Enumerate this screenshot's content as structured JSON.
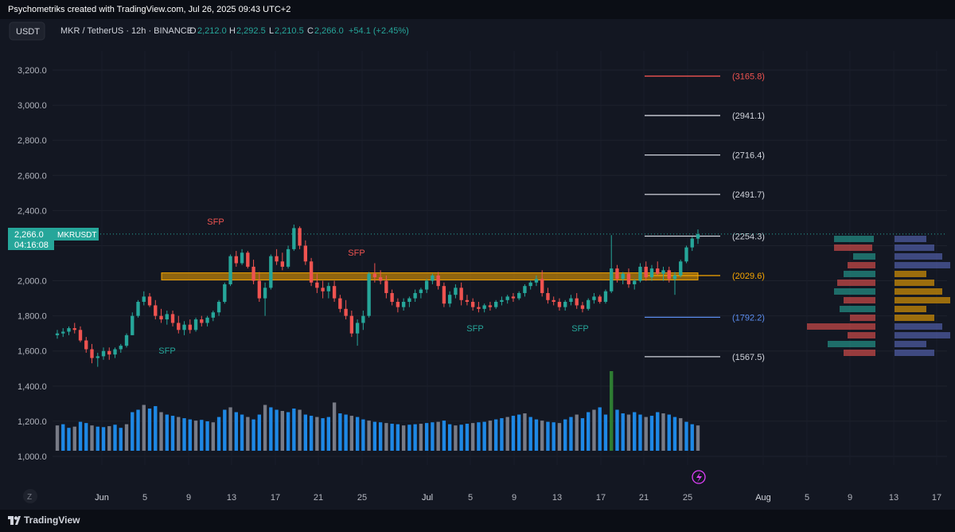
{
  "header": {
    "credit": "Psychometriks created with TradingView.com, Jul 26, 2025 09:43 UTC+2",
    "currency_button": "USDT",
    "symbol": "MKR / TetherUS · 12h · BINANCE",
    "o_label": "O",
    "o": "2,212.0",
    "h_label": "H",
    "h": "2,292.5",
    "l_label": "L",
    "l": "2,210.5",
    "c_label": "C",
    "c": "2,266.0",
    "change": "+54.1 (+2.45%)"
  },
  "price_tag": {
    "price": "2,266.0",
    "countdown": "04:16:08",
    "symbol": "MKRUSDT"
  },
  "footer": {
    "brand": "TradingView",
    "z_button": "Z"
  },
  "colors": {
    "up": "#26a69a",
    "down": "#ef5350",
    "bg": "#131722",
    "grid": "#1e222d",
    "zone": "#f7a600"
  },
  "chart_data": {
    "type": "candlestick",
    "symbol": "MKRUSDT",
    "interval": "12h",
    "ylim": [
      950,
      3350
    ],
    "y_ticks": [
      "3,200.0",
      "3,000.0",
      "2,800.0",
      "2,600.0",
      "2,400.0",
      "2,200.0",
      "2,000.0",
      "1,800.0",
      "1,600.0",
      "1,400.0",
      "1,200.0",
      "1,000.0"
    ],
    "y_tick_values": [
      3200,
      3000,
      2800,
      2600,
      2400,
      2200,
      2000,
      1800,
      1600,
      1400,
      1200,
      1000
    ],
    "x_ticks": [
      "Jun",
      "5",
      "9",
      "13",
      "17",
      "21",
      "25",
      "Jul",
      "5",
      "9",
      "13",
      "17",
      "21",
      "25",
      "Aug",
      "5",
      "9",
      "13",
      "17"
    ],
    "candles": [
      [
        1690,
        1720,
        1670,
        1700
      ],
      [
        1700,
        1730,
        1680,
        1710
      ],
      [
        1710,
        1740,
        1690,
        1730
      ],
      [
        1730,
        1760,
        1700,
        1720
      ],
      [
        1720,
        1740,
        1650,
        1660
      ],
      [
        1660,
        1680,
        1590,
        1610
      ],
      [
        1610,
        1640,
        1530,
        1560
      ],
      [
        1560,
        1590,
        1510,
        1570
      ],
      [
        1570,
        1620,
        1550,
        1600
      ],
      [
        1600,
        1620,
        1550,
        1580
      ],
      [
        1580,
        1620,
        1560,
        1610
      ],
      [
        1610,
        1640,
        1590,
        1630
      ],
      [
        1630,
        1700,
        1620,
        1690
      ],
      [
        1690,
        1820,
        1690,
        1800
      ],
      [
        1800,
        1890,
        1790,
        1880
      ],
      [
        1880,
        1940,
        1860,
        1910
      ],
      [
        1910,
        1930,
        1850,
        1860
      ],
      [
        1860,
        1890,
        1780,
        1800
      ],
      [
        1800,
        1840,
        1760,
        1780
      ],
      [
        1780,
        1830,
        1750,
        1810
      ],
      [
        1810,
        1830,
        1740,
        1760
      ],
      [
        1760,
        1800,
        1700,
        1720
      ],
      [
        1720,
        1770,
        1690,
        1750
      ],
      [
        1750,
        1780,
        1700,
        1720
      ],
      [
        1720,
        1790,
        1710,
        1780
      ],
      [
        1780,
        1800,
        1740,
        1760
      ],
      [
        1760,
        1800,
        1740,
        1790
      ],
      [
        1790,
        1830,
        1770,
        1820
      ],
      [
        1820,
        1890,
        1800,
        1880
      ],
      [
        1880,
        1990,
        1870,
        1980
      ],
      [
        1980,
        2150,
        1970,
        2140
      ],
      [
        2140,
        2170,
        2080,
        2100
      ],
      [
        2100,
        2180,
        2090,
        2160
      ],
      [
        2160,
        2170,
        2070,
        2080
      ],
      [
        2080,
        2120,
        1980,
        2000
      ],
      [
        2000,
        2050,
        1880,
        1900
      ],
      [
        1900,
        1990,
        1800,
        1960
      ],
      [
        1960,
        2150,
        1950,
        2140
      ],
      [
        2140,
        2180,
        2090,
        2110
      ],
      [
        2110,
        2160,
        2060,
        2080
      ],
      [
        2080,
        2200,
        2070,
        2180
      ],
      [
        2180,
        2320,
        2170,
        2300
      ],
      [
        2300,
        2310,
        2180,
        2200
      ],
      [
        2200,
        2230,
        2090,
        2110
      ],
      [
        2110,
        2130,
        1970,
        1990
      ],
      [
        1990,
        2040,
        1930,
        1960
      ],
      [
        1960,
        2000,
        1900,
        1940
      ],
      [
        1940,
        1990,
        1900,
        1970
      ],
      [
        1970,
        2000,
        1880,
        1900
      ],
      [
        1900,
        1920,
        1820,
        1840
      ],
      [
        1840,
        1890,
        1780,
        1800
      ],
      [
        1800,
        1830,
        1680,
        1700
      ],
      [
        1700,
        1780,
        1630,
        1760
      ],
      [
        1760,
        1830,
        1720,
        1800
      ],
      [
        1800,
        2050,
        1790,
        2040
      ],
      [
        2040,
        2100,
        1990,
        2020
      ],
      [
        2020,
        2060,
        1980,
        2000
      ],
      [
        2000,
        2030,
        1900,
        1930
      ],
      [
        1930,
        1950,
        1860,
        1880
      ],
      [
        1880,
        1900,
        1820,
        1850
      ],
      [
        1850,
        1900,
        1830,
        1880
      ],
      [
        1880,
        1910,
        1850,
        1900
      ],
      [
        1900,
        1950,
        1880,
        1930
      ],
      [
        1930,
        1960,
        1900,
        1950
      ],
      [
        1950,
        2010,
        1930,
        2000
      ],
      [
        2000,
        2040,
        1980,
        2030
      ],
      [
        2030,
        2050,
        1950,
        1970
      ],
      [
        1970,
        1990,
        1850,
        1870
      ],
      [
        1870,
        1940,
        1850,
        1920
      ],
      [
        1920,
        1980,
        1900,
        1960
      ],
      [
        1960,
        1990,
        1860,
        1890
      ],
      [
        1890,
        1920,
        1860,
        1880
      ],
      [
        1880,
        1900,
        1830,
        1850
      ],
      [
        1850,
        1880,
        1820,
        1840
      ],
      [
        1840,
        1870,
        1820,
        1860
      ],
      [
        1860,
        1880,
        1830,
        1850
      ],
      [
        1850,
        1890,
        1840,
        1880
      ],
      [
        1880,
        1910,
        1860,
        1890
      ],
      [
        1890,
        1920,
        1870,
        1910
      ],
      [
        1910,
        1930,
        1880,
        1900
      ],
      [
        1900,
        1940,
        1890,
        1930
      ],
      [
        1930,
        1980,
        1910,
        1970
      ],
      [
        1970,
        2000,
        1950,
        1990
      ],
      [
        1990,
        2030,
        1970,
        2010
      ],
      [
        2010,
        2060,
        1910,
        1930
      ],
      [
        1930,
        1960,
        1870,
        1890
      ],
      [
        1890,
        1910,
        1860,
        1880
      ],
      [
        1880,
        1900,
        1830,
        1850
      ],
      [
        1850,
        1890,
        1830,
        1880
      ],
      [
        1880,
        1920,
        1860,
        1900
      ],
      [
        1900,
        1930,
        1840,
        1860
      ],
      [
        1860,
        1880,
        1820,
        1840
      ],
      [
        1840,
        1900,
        1830,
        1890
      ],
      [
        1890,
        1930,
        1870,
        1910
      ],
      [
        1910,
        1920,
        1870,
        1880
      ],
      [
        1880,
        1950,
        1870,
        1940
      ],
      [
        1940,
        2260,
        1930,
        2070
      ],
      [
        2070,
        2090,
        1990,
        2010
      ],
      [
        2010,
        2050,
        1980,
        2040
      ],
      [
        2040,
        2070,
        1960,
        1980
      ],
      [
        1980,
        2010,
        1950,
        2000
      ],
      [
        2000,
        2100,
        1990,
        2080
      ],
      [
        2080,
        2110,
        2000,
        2020
      ],
      [
        2020,
        2090,
        2000,
        2070
      ],
      [
        2070,
        2110,
        2030,
        2040
      ],
      [
        2040,
        2080,
        2000,
        2060
      ],
      [
        2060,
        2080,
        1990,
        2010
      ],
      [
        2010,
        2050,
        1920,
        2030
      ],
      [
        2030,
        2120,
        2020,
        2110
      ],
      [
        2110,
        2200,
        2100,
        2190
      ],
      [
        2190,
        2250,
        2170,
        2240
      ],
      [
        2240,
        2292,
        2210,
        2266
      ]
    ],
    "levels": [
      {
        "label": "(3165.8)",
        "value": 3165.8,
        "color": "#ef5350"
      },
      {
        "label": "(2941.1)",
        "value": 2941.1,
        "color": "#d1d4dc"
      },
      {
        "label": "(2716.4)",
        "value": 2716.4,
        "color": "#d1d4dc"
      },
      {
        "label": "(2491.7)",
        "value": 2491.7,
        "color": "#d1d4dc"
      },
      {
        "label": "(2254.3)",
        "value": 2254.3,
        "color": "#d1d4dc"
      },
      {
        "label": "(2029.6)",
        "value": 2029.6,
        "color": "#f7a600"
      },
      {
        "label": "(1792.2)",
        "value": 1792.2,
        "color": "#5b8def"
      },
      {
        "label": "(1567.5)",
        "value": 1567.5,
        "color": "#d1d4dc"
      }
    ],
    "zone": {
      "low": 2005,
      "high": 2045
    },
    "annotations": [
      {
        "text": "SFP",
        "color": "#26a69a",
        "near": "early June low"
      },
      {
        "text": "SFP",
        "color": "#ef5350",
        "near": "mid June high"
      },
      {
        "text": "SFP",
        "color": "#ef5350",
        "near": "June 24 high"
      },
      {
        "text": "SFP",
        "color": "#26a69a",
        "near": "July 7 low"
      },
      {
        "text": "SFP",
        "color": "#26a69a",
        "near": "July 16 low"
      }
    ],
    "volume": [
      105,
      110,
      95,
      100,
      120,
      115,
      105,
      100,
      98,
      102,
      108,
      95,
      110,
      160,
      170,
      190,
      175,
      185,
      160,
      150,
      145,
      140,
      135,
      130,
      125,
      128,
      122,
      118,
      140,
      170,
      180,
      160,
      150,
      140,
      130,
      150,
      190,
      180,
      170,
      165,
      160,
      175,
      170,
      150,
      145,
      140,
      135,
      140,
      200,
      155,
      150,
      145,
      140,
      130,
      125,
      120,
      118,
      115,
      112,
      110,
      105,
      108,
      110,
      112,
      115,
      118,
      120,
      125,
      110,
      105,
      108,
      112,
      115,
      118,
      120,
      125,
      130,
      135,
      140,
      145,
      150,
      155,
      140,
      130,
      125,
      120,
      118,
      115,
      130,
      140,
      150,
      135,
      160,
      170,
      180,
      150,
      330,
      170,
      155,
      150,
      160,
      150,
      140,
      145,
      160,
      155,
      150,
      140,
      135,
      120,
      110,
      105
    ]
  }
}
